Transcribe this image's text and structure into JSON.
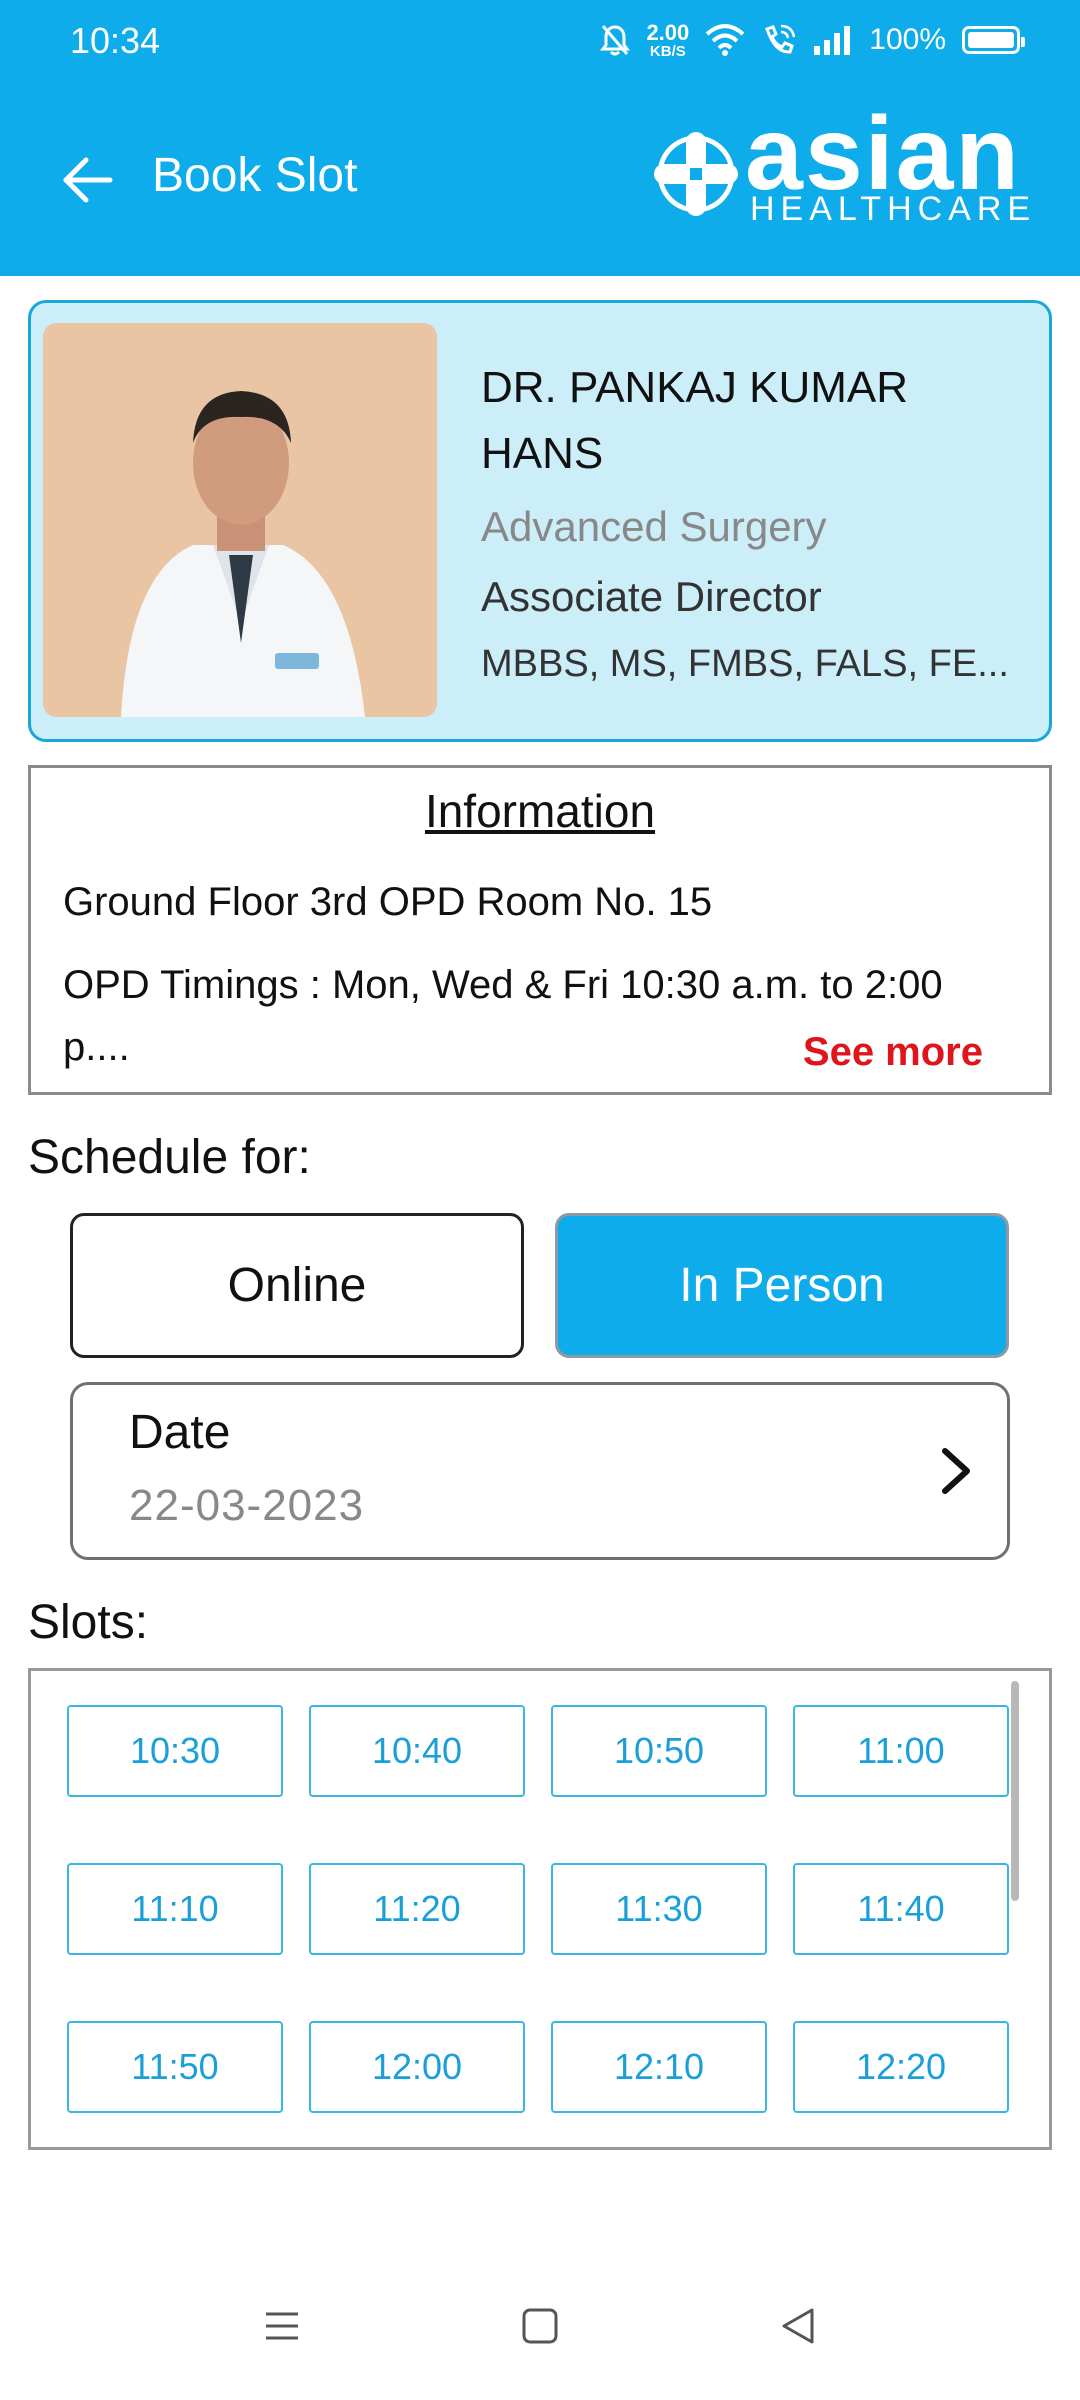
{
  "status_bar": {
    "time": "10:34",
    "net_speed_value": "2.00",
    "net_speed_unit": "KB/S",
    "battery": "100%",
    "icons": [
      "mute-icon",
      "wifi-icon",
      "wifi-calling-icon",
      "signal-icon",
      "battery-icon"
    ]
  },
  "header": {
    "title": "Book Slot",
    "back_icon": "arrow-left-icon",
    "logo_word": "asian",
    "logo_sub": "HEALTHCARE"
  },
  "doctor": {
    "name": "DR. PANKAJ KUMAR HANS",
    "specialty": "Advanced Surgery",
    "role": "Associate Director",
    "qualifications": "MBBS, MS, FMBS, FALS, FE..."
  },
  "information": {
    "title": "Information",
    "location": "Ground Floor 3rd OPD Room No. 15",
    "timings": "OPD Timings : Mon, Wed & Fri 10:30 a.m. to 2:00 p....",
    "see_more": "See more"
  },
  "schedule": {
    "label": "Schedule for:",
    "online": "Online",
    "in_person": "In Person",
    "selected": "In Person"
  },
  "date": {
    "label": "Date",
    "value": "22-03-2023"
  },
  "slots": {
    "label": "Slots:",
    "times": [
      "10:30",
      "10:40",
      "10:50",
      "11:00",
      "11:10",
      "11:20",
      "11:30",
      "11:40",
      "11:50",
      "12:00",
      "12:10",
      "12:20"
    ]
  },
  "colors": {
    "brand": "#0eacea",
    "card_bg": "#cbeef9",
    "see_more": "#e0141a",
    "slot_text": "#1a9fd8"
  }
}
